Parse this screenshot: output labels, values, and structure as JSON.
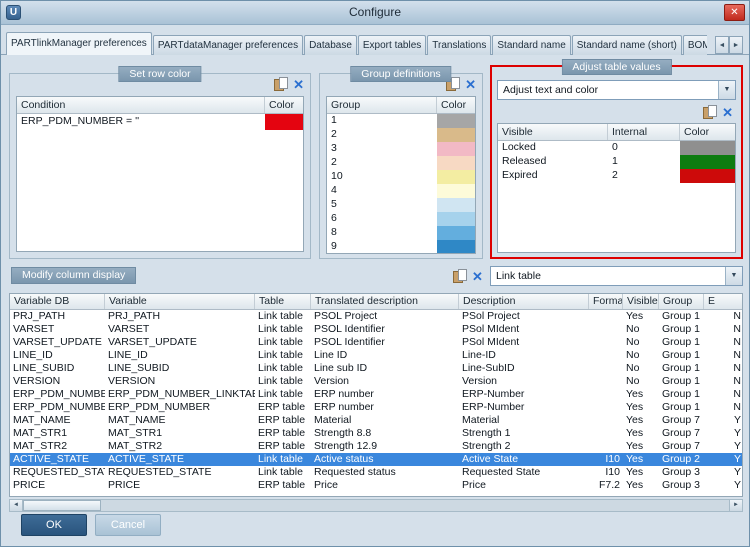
{
  "window": {
    "title": "Configure",
    "close_glyph": "✕",
    "app_icon_glyph": "U"
  },
  "tabs": {
    "items": [
      "PARTlinkManager preferences",
      "PARTdataManager preferences",
      "Database",
      "Export tables",
      "Translations",
      "Standard name",
      "Standard name (short)",
      "BOM name"
    ],
    "active_index": 0,
    "scroll_left_glyph": "◄",
    "scroll_right_glyph": "►"
  },
  "set_row_color": {
    "title": "Set row color",
    "columns": [
      "Condition",
      "Color"
    ],
    "rows": [
      {
        "condition": "ERP_PDM_NUMBER = ''",
        "color": "#e40410"
      }
    ]
  },
  "group_definitions": {
    "title": "Group definitions",
    "columns": [
      "Group",
      "Color"
    ],
    "rows": [
      {
        "group": "1",
        "color": "#a6a6a6"
      },
      {
        "group": "2",
        "color": "#d9ba8a"
      },
      {
        "group": "3",
        "color": "#f2b9c5"
      },
      {
        "group": "2",
        "color": "#f7d9c3"
      },
      {
        "group": "10",
        "color": "#f3eda2"
      },
      {
        "group": "4",
        "color": "#fdfbd9"
      },
      {
        "group": "5",
        "color": "#d0e5f2"
      },
      {
        "group": "6",
        "color": "#a6d2ec"
      },
      {
        "group": "8",
        "color": "#63aede"
      },
      {
        "group": "9",
        "color": "#2f88c6"
      }
    ]
  },
  "adjust_table_values": {
    "title": "Adjust table values",
    "highlight_color": "#dd0000",
    "mode_dropdown": {
      "value": "Adjust text and color",
      "arrow_glyph": "▼"
    },
    "columns": [
      "Visible",
      "Internal",
      "Color"
    ],
    "rows": [
      {
        "visible": "Locked",
        "internal": "0",
        "color": "#8f8f8f"
      },
      {
        "visible": "Released",
        "internal": "1",
        "color": "#0e7c10"
      },
      {
        "visible": "Expired",
        "internal": "2",
        "color": "#cd0a0a"
      }
    ]
  },
  "modify_column_display": {
    "title": "Modify column display",
    "table_dropdown": {
      "value": "Link table",
      "arrow_glyph": "▼"
    }
  },
  "main_table": {
    "columns": [
      "Variable DB",
      "Variable",
      "Table",
      "Translated description",
      "Description",
      "Format",
      "Visible",
      "Group",
      "E"
    ],
    "selected_index": 11,
    "rows": [
      [
        "PRJ_PATH",
        "PRJ_PATH",
        "Link table",
        "PSOL Project",
        "PSol Project",
        "",
        "Yes",
        "Group 1",
        "N"
      ],
      [
        "VARSET",
        "VARSET",
        "Link table",
        "PSOL Identifier",
        "PSol MIdent",
        "",
        "No",
        "Group 1",
        "N"
      ],
      [
        "VARSET_UPDATE",
        "VARSET_UPDATE",
        "Link table",
        "PSOL Identifier",
        "PSol MIdent",
        "",
        "No",
        "Group 1",
        "N"
      ],
      [
        "LINE_ID",
        "LINE_ID",
        "Link table",
        "Line ID",
        "Line-ID",
        "",
        "No",
        "Group 1",
        "N"
      ],
      [
        "LINE_SUBID",
        "LINE_SUBID",
        "Link table",
        "Line sub ID",
        "Line-SubID",
        "",
        "No",
        "Group 1",
        "N"
      ],
      [
        "VERSION",
        "VERSION",
        "Link table",
        "Version",
        "Version",
        "",
        "No",
        "Group 1",
        "N"
      ],
      [
        "ERP_PDM_NUMBER",
        "ERP_PDM_NUMBER_LINKTABLE",
        "Link table",
        "ERP number",
        "ERP-Number",
        "",
        "Yes",
        "Group 1",
        "N"
      ],
      [
        "ERP_PDM_NUMBER",
        "ERP_PDM_NUMBER",
        "ERP table",
        "ERP number",
        "ERP-Number",
        "",
        "Yes",
        "Group 1",
        "N"
      ],
      [
        "MAT_NAME",
        "MAT_NAME",
        "ERP table",
        "Material",
        "Material",
        "",
        "Yes",
        "Group 7",
        "Y"
      ],
      [
        "MAT_STR1",
        "MAT_STR1",
        "ERP table",
        "Strength 8.8",
        "Strength 1",
        "",
        "Yes",
        "Group 7",
        "Y"
      ],
      [
        "MAT_STR2",
        "MAT_STR2",
        "ERP table",
        "Strength 12.9",
        "Strength 2",
        "",
        "Yes",
        "Group 7",
        "Y"
      ],
      [
        "ACTIVE_STATE",
        "ACTIVE_STATE",
        "Link table",
        "Active status",
        "Active State",
        "I10",
        "Yes",
        "Group 2",
        "Y"
      ],
      [
        "REQUESTED_STATE",
        "REQUESTED_STATE",
        "Link table",
        "Requested status",
        "Requested State",
        "I10",
        "Yes",
        "Group 3",
        "Y"
      ],
      [
        "PRICE",
        "PRICE",
        "ERP table",
        "Price",
        "Price",
        "F7.2",
        "Yes",
        "Group 3",
        "Y"
      ]
    ]
  },
  "scrollbar": {
    "left_glyph": "◄",
    "right_glyph": "►"
  },
  "footer": {
    "ok_label": "OK",
    "cancel_label": "Cancel"
  }
}
